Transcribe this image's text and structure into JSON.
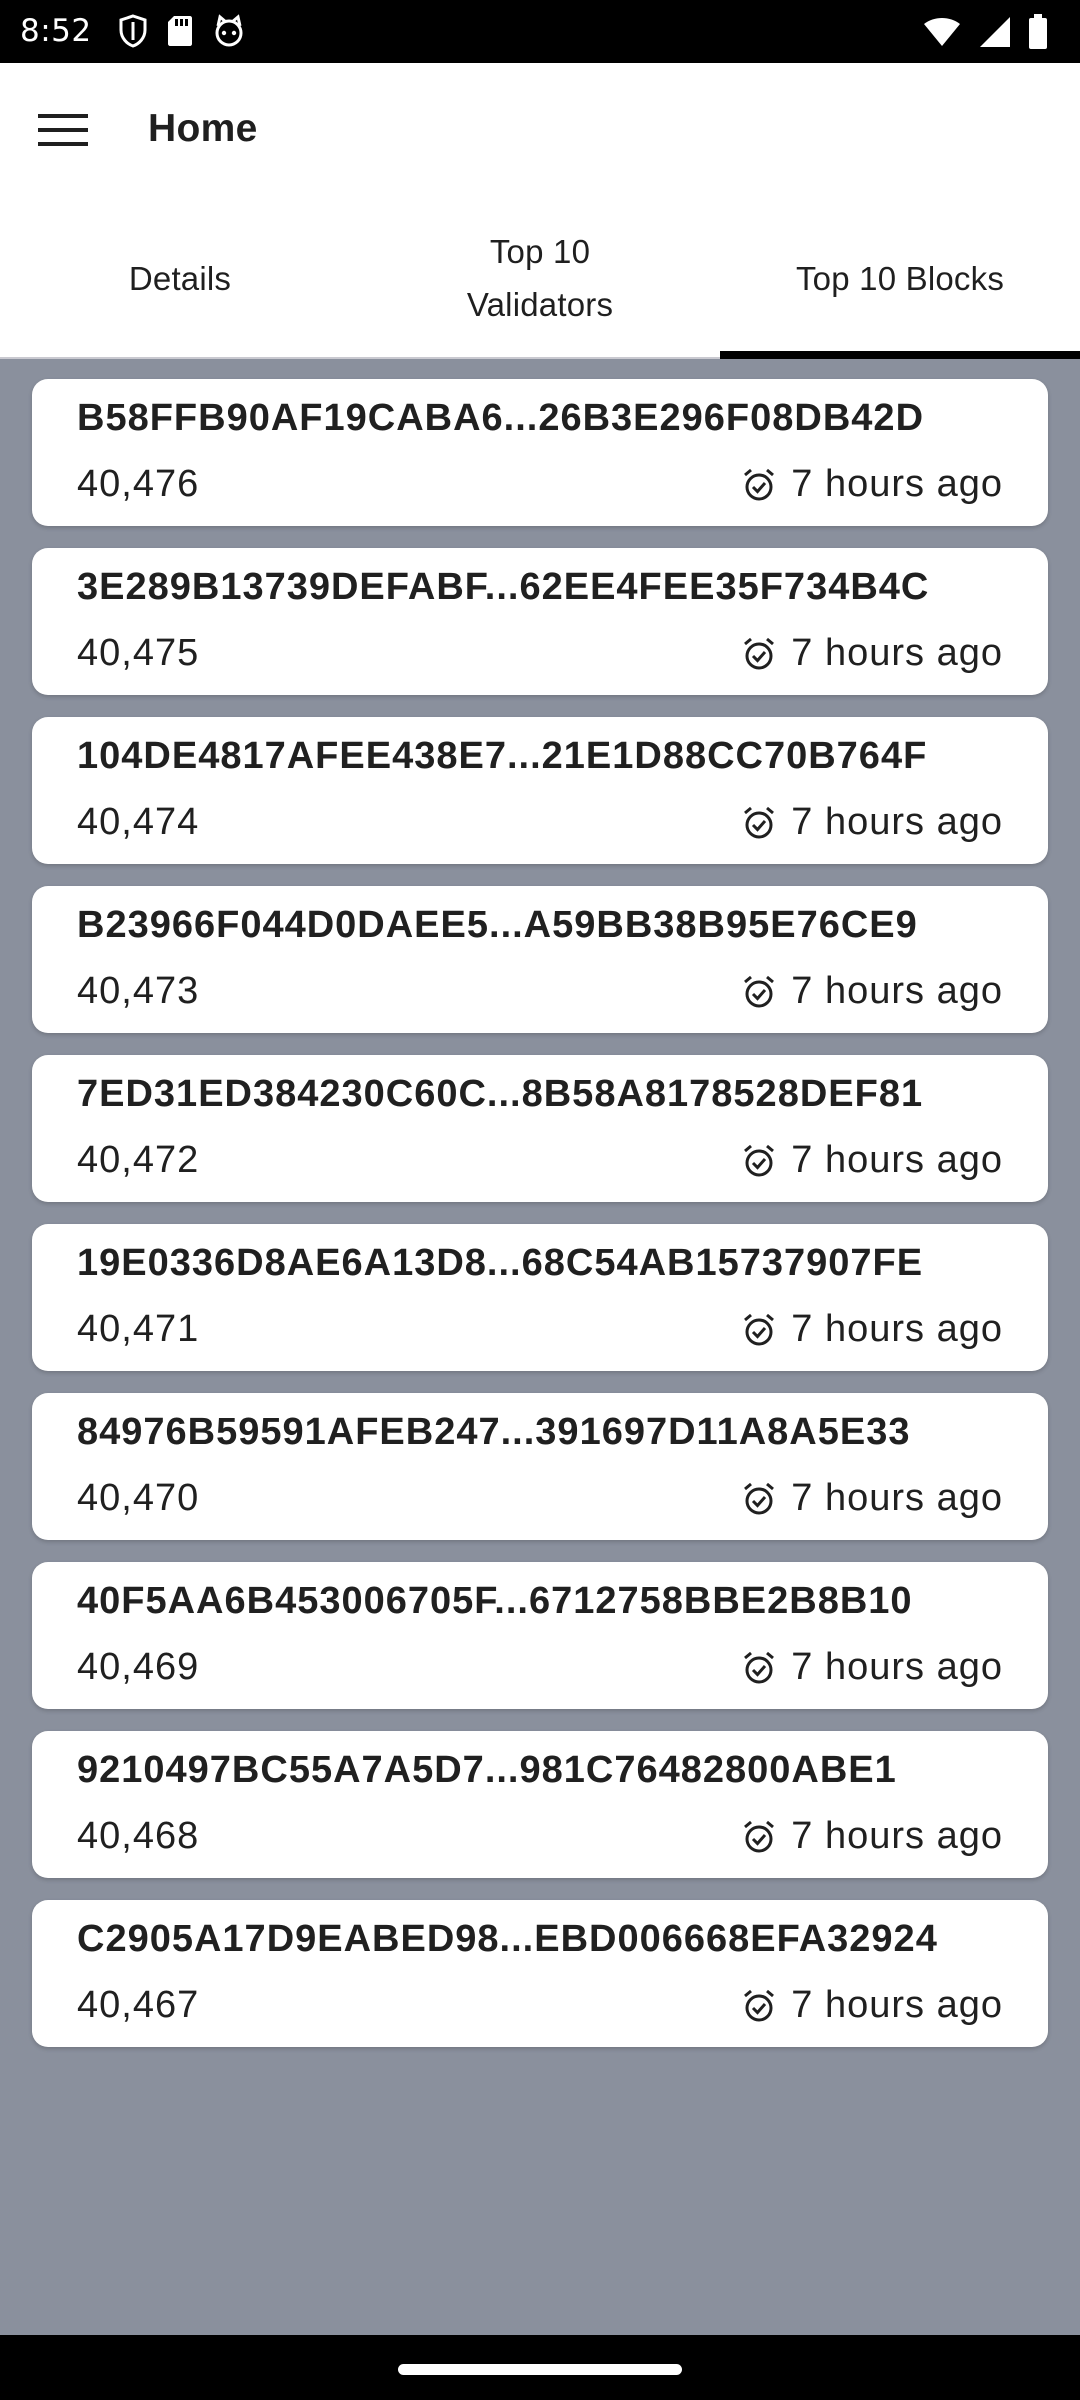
{
  "status_bar": {
    "time": "8:52",
    "left_icons": [
      "shield-icon",
      "sd-card-icon",
      "cat-face-icon"
    ],
    "right_icons": [
      "wifi-icon",
      "signal-icon",
      "battery-icon"
    ]
  },
  "app_bar": {
    "menu_icon": "hamburger-menu-icon",
    "title": "Home"
  },
  "tabs": [
    {
      "label": "Details",
      "active": false
    },
    {
      "label": "Top 10 Validators",
      "active": false
    },
    {
      "label": "Top 10 Blocks",
      "active": true
    }
  ],
  "blocks": [
    {
      "hash": "B58FFB90AF19CABA6...26B3E296F08DB42D",
      "height": "40,476",
      "time": "7 hours ago"
    },
    {
      "hash": "3E289B13739DEFABF...62EE4FEE35F734B4C",
      "height": "40,475",
      "time": "7 hours ago"
    },
    {
      "hash": "104DE4817AFEE438E7...21E1D88CC70B764F",
      "height": "40,474",
      "time": "7 hours ago"
    },
    {
      "hash": "B23966F044D0DAEE5...A59BB38B95E76CE9",
      "height": "40,473",
      "time": "7 hours ago"
    },
    {
      "hash": "7ED31ED384230C60C...8B58A8178528DEF81",
      "height": "40,472",
      "time": "7 hours ago"
    },
    {
      "hash": "19E0336D8AE6A13D8...68C54AB15737907FE",
      "height": "40,471",
      "time": "7 hours ago"
    },
    {
      "hash": "84976B59591AFEB247...391697D11A8A5E33",
      "height": "40,470",
      "time": "7 hours ago"
    },
    {
      "hash": "40F5AA6B453006705F...6712758BBE2B8B10",
      "height": "40,469",
      "time": "7 hours ago"
    },
    {
      "hash": "9210497BC55A7A5D7...981C76482800ABE1",
      "height": "40,468",
      "time": "7 hours ago"
    },
    {
      "hash": "C2905A17D9EABED98...EBD006668EFA32924",
      "height": "40,467",
      "time": "7 hours ago"
    }
  ],
  "block_time_icon": "alarm-clock-icon",
  "colors": {
    "content_background": "#8a909d",
    "card_background": "#ffffff",
    "active_tab_indicator": "#000000"
  }
}
